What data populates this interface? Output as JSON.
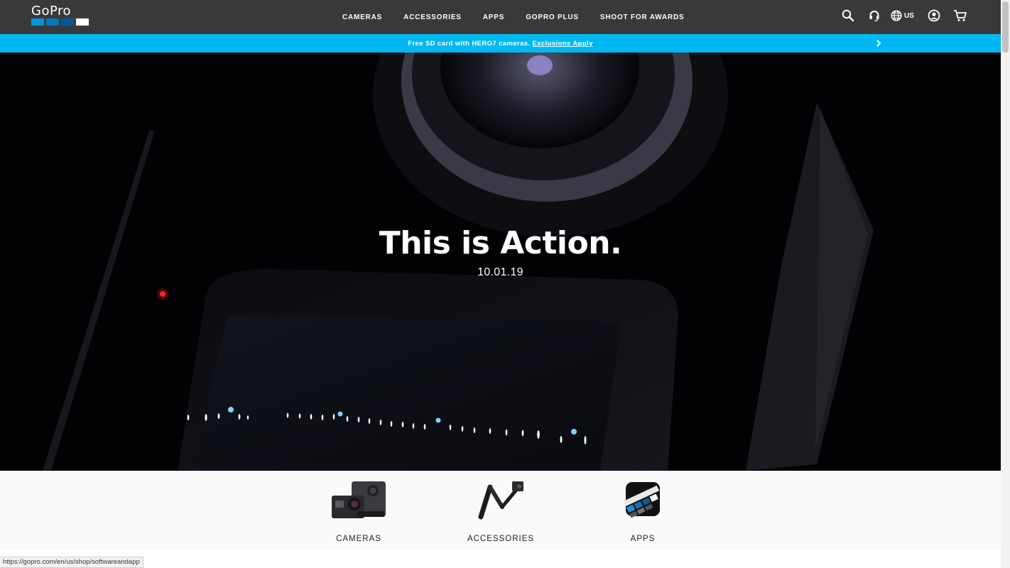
{
  "brand": {
    "name": "GoPro",
    "square_colors": [
      "#0097d6",
      "#0078b8",
      "#005a9e",
      "#ffffff"
    ]
  },
  "header": {
    "nav": [
      "CAMERAS",
      "ACCESSORIES",
      "APPS",
      "GOPRO PLUS",
      "SHOOT FOR AWARDS"
    ],
    "region": "US",
    "icons": [
      "search-icon",
      "support-headset-icon",
      "globe-icon",
      "account-icon",
      "cart-icon"
    ]
  },
  "promo": {
    "text": "Free SD card with HERO7 cameras.",
    "link": "Exclusions Apply",
    "background": "#00b8f1"
  },
  "hero": {
    "title": "This is Action.",
    "date": "10.01.19"
  },
  "categories": [
    {
      "label": "CAMERAS",
      "icon": "cameras-thumbnail"
    },
    {
      "label": "ACCESSORIES",
      "icon": "accessories-thumbnail"
    },
    {
      "label": "APPS",
      "icon": "apps-thumbnail"
    }
  ],
  "status_bar": {
    "url": "https://gopro.com/en/us/shop/softwareandapp"
  }
}
